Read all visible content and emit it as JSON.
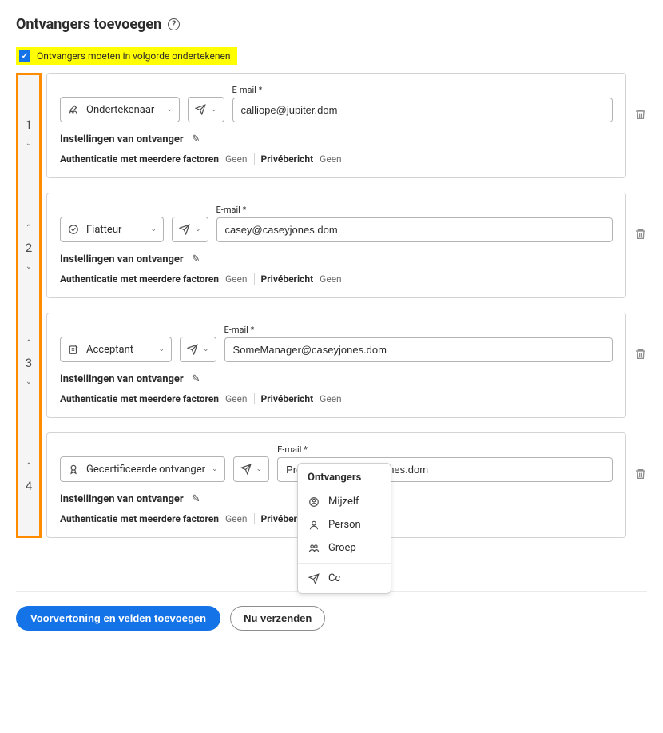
{
  "title": "Ontvangers toevoegen",
  "order_checkbox_label": "Ontvangers moeten in volgorde ondertekenen",
  "email_field_label": "E-mail",
  "required_mark": "*",
  "settings_title": "Instellingen van ontvanger",
  "mfa_label": "Authenticatie met meerdere factoren",
  "mfa_value": "Geen",
  "pm_label": "Privébericht",
  "pm_value": "Geen",
  "recipients": [
    {
      "order": "1",
      "role": "Ondertekenaar",
      "email": "calliope@jupiter.dom",
      "has_up": false,
      "has_down": true
    },
    {
      "order": "2",
      "role": "Fiatteur",
      "email": "casey@caseyjones.dom",
      "has_up": true,
      "has_down": true
    },
    {
      "order": "3",
      "role": "Acceptant",
      "email": "SomeManager@caseyjones.dom",
      "has_up": true,
      "has_down": true
    },
    {
      "order": "4",
      "role": "Gecertificeerde ontvanger",
      "email": "Provisioning@caseyjones.dom",
      "email_visible": "Provisioning@case",
      "has_up": true,
      "has_down": false
    }
  ],
  "popover": {
    "title": "Ontvangers",
    "items": [
      "Mijzelf",
      "Person",
      "Groep",
      "Cc"
    ]
  },
  "buttons": {
    "primary": "Voorvertoning en velden toevoegen",
    "secondary": "Nu verzenden"
  }
}
